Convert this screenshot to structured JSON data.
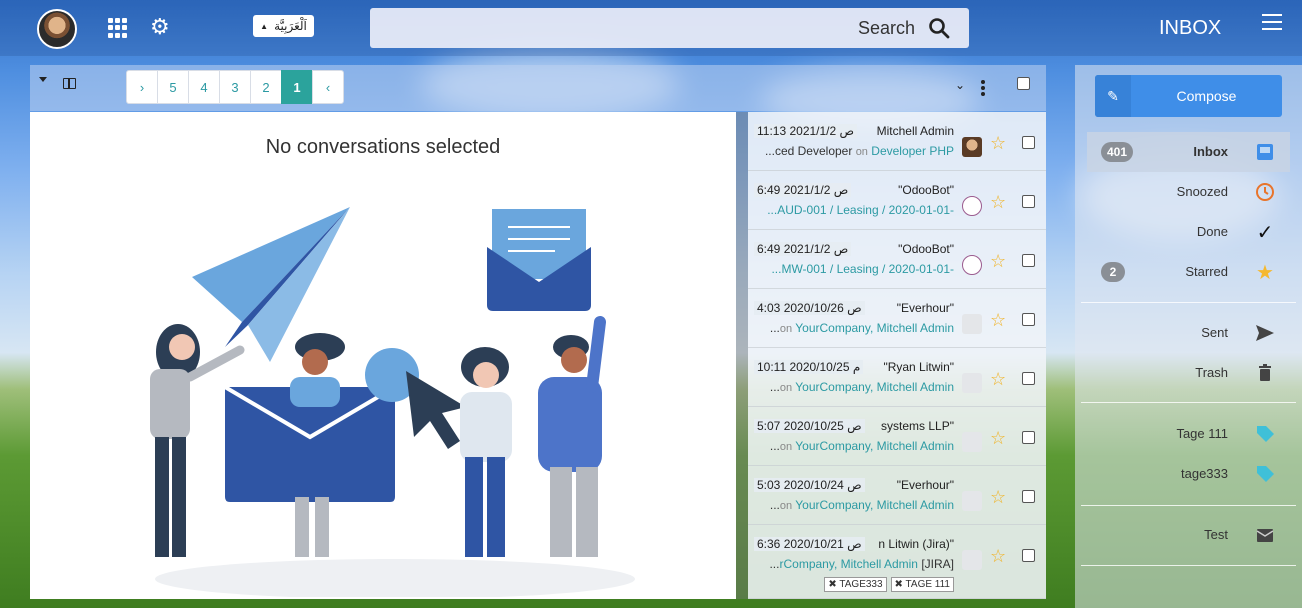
{
  "header": {
    "language": "اَلْعَرَبِيَّة",
    "search_label": "Search",
    "title": "INBOX"
  },
  "toolbar": {
    "pages": [
      "›",
      "5",
      "4",
      "3",
      "2",
      "1",
      "‹"
    ],
    "active_page": "1"
  },
  "preview": {
    "empty_message": "No conversations selected"
  },
  "messages": [
    {
      "date": "11:13 2021/1/2 ص",
      "sender": "Mitchell Admin",
      "subject_prefix": "...ced Developer",
      "on": "on",
      "subject_link": "Developer PHP",
      "avatar": "photo",
      "tags": []
    },
    {
      "date": "6:49 2021/1/2 ص",
      "sender": "\"OdooBot\"",
      "subject_prefix": "",
      "on": "",
      "subject_link": "...AUD-001 / Leasing / 2020-01-01-",
      "avatar": "odoobot",
      "tags": []
    },
    {
      "date": "6:49 2021/1/2 ص",
      "sender": "\"OdooBot\"",
      "subject_prefix": "",
      "on": "",
      "subject_link": "...MW-001 / Leasing / 2020-01-01-",
      "avatar": "odoobot",
      "tags": []
    },
    {
      "date": "4:03 2020/10/26 ص",
      "sender": "\"Everhour\"",
      "subject_prefix": "...",
      "on": "on",
      "subject_link": "YourCompany, Mitchell Admin",
      "avatar": "placeholder",
      "tags": []
    },
    {
      "date": "10:11 2020/10/25 م",
      "sender": "\"Ryan Litwin\"",
      "subject_prefix": "...",
      "on": "on",
      "subject_link": "YourCompany, Mitchell Admin",
      "avatar": "placeholder",
      "tags": []
    },
    {
      "date": "5:07 2020/10/25 ص",
      "sender": "systems LLP\"",
      "subject_prefix": "...",
      "on": "on",
      "subject_link": "YourCompany, Mitchell Admin",
      "avatar": "placeholder",
      "tags": []
    },
    {
      "date": "5:03 2020/10/24 ص",
      "sender": "\"Everhour\"",
      "subject_prefix": "...",
      "on": "on",
      "subject_link": "YourCompany, Mitchell Admin",
      "avatar": "placeholder",
      "tags": []
    },
    {
      "date": "6:36 2020/10/21 ص",
      "sender": "n Litwin (Jira)\"",
      "subject_prefix": "...",
      "on": "",
      "subject_link": "rCompany, Mitchell Admin",
      "subject_suffix": " [JIRA]",
      "avatar": "placeholder",
      "tags": [
        "TAGE333",
        "TAGE 111"
      ]
    }
  ],
  "sidebar": {
    "compose_label": "Compose",
    "items": [
      {
        "label": "Inbox",
        "badge": "401",
        "icon": "inbox-icon",
        "color": "#3f8ee8"
      },
      {
        "label": "Snoozed",
        "badge": "",
        "icon": "clock-icon",
        "color": "#e8742b"
      },
      {
        "label": "Done",
        "badge": "",
        "icon": "check-icon",
        "color": "#111111"
      },
      {
        "label": "Starred",
        "badge": "2",
        "icon": "star-icon",
        "color": "#f5b82e"
      },
      {
        "label": "Sent",
        "badge": "",
        "icon": "send-icon",
        "color": "#444444"
      },
      {
        "label": "Trash",
        "badge": "",
        "icon": "trash-icon",
        "color": "#444444"
      },
      {
        "label": "Tage 111",
        "badge": "",
        "icon": "tag-icon",
        "color": "#3fc0d8"
      },
      {
        "label": "tage333",
        "badge": "",
        "icon": "tag-icon",
        "color": "#3fc0d8"
      },
      {
        "label": "Test",
        "badge": "",
        "icon": "mailbox-icon",
        "color": "#444444"
      }
    ]
  },
  "colors": {
    "accent": "#3f8ee8",
    "teal": "#2ba39c",
    "star": "#f0b429"
  }
}
